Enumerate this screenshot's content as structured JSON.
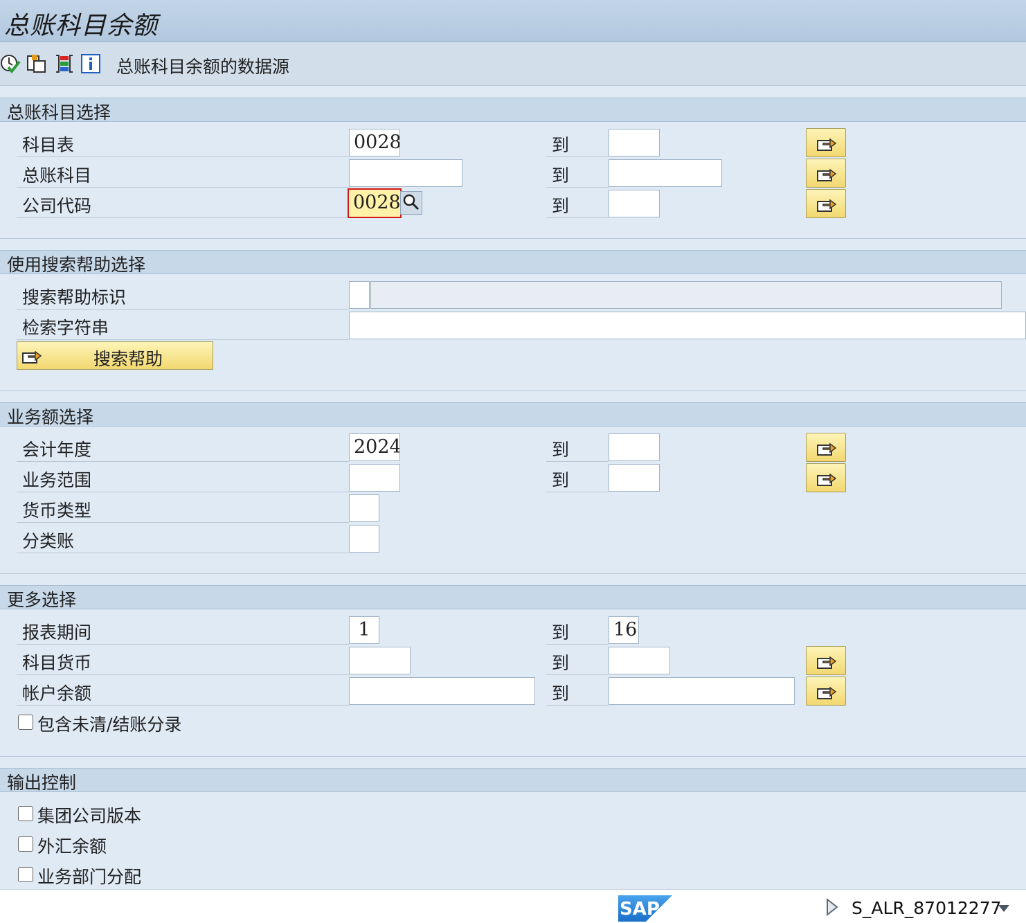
{
  "window": {
    "title": "总账科目余额"
  },
  "toolbar": {
    "icons": [
      "execute-icon",
      "copy-icon",
      "variant-icon",
      "info-icon"
    ],
    "data_source_label": "总账科目余额的数据源"
  },
  "sections": {
    "gl_account_selection": {
      "heading": "总账科目选择",
      "rows": {
        "chart": {
          "label": "科目表",
          "from": "0028",
          "to_label": "到",
          "to": ""
        },
        "account": {
          "label": "总账科目",
          "from": "",
          "to_label": "到",
          "to": ""
        },
        "company": {
          "label": "公司代码",
          "from": "0028",
          "to_label": "到",
          "to": ""
        }
      }
    },
    "search_help": {
      "heading": "使用搜索帮助选择",
      "id_label": "搜索帮助标识",
      "id_value": "",
      "id_desc": "",
      "search_string_label": "检索字符串",
      "search_string": "",
      "button_label": "搜索帮助"
    },
    "transaction_figures": {
      "heading": "业务额选择",
      "rows": {
        "fiscal_year": {
          "label": "会计年度",
          "from": "2024",
          "to_label": "到",
          "to": ""
        },
        "business_area": {
          "label": "业务范围",
          "from": "",
          "to_label": "到",
          "to": ""
        },
        "currency_type": {
          "label": "货币类型",
          "value": ""
        },
        "ledger": {
          "label": "分类账",
          "value": ""
        }
      }
    },
    "further_selections": {
      "heading": "更多选择",
      "rows": {
        "period": {
          "label": "报表期间",
          "from": "1",
          "to_label": "到",
          "to": "16"
        },
        "account_currency": {
          "label": "科目货币",
          "from": "",
          "to_label": "到",
          "to": ""
        },
        "balance": {
          "label": "帐户余额",
          "from": "",
          "to_label": "到",
          "to": ""
        }
      },
      "checkbox_open_close": "包含未清/结账分录"
    },
    "output_control": {
      "heading": "输出控制",
      "checkboxes": [
        "集团公司版本",
        "外汇余额",
        "业务部门分配"
      ]
    }
  },
  "footer": {
    "logo_text": "SAP",
    "transaction_code": "S_ALR_87012277"
  },
  "colors": {
    "title_bar": "#b8cce2",
    "background": "#dfeaf5",
    "section_header": "#c7d8e9",
    "button_yellow": "#f6e08a",
    "focus_border": "#d01818",
    "focus_fill": "#fff2a8",
    "sap_blue": "#1a6fc9"
  }
}
